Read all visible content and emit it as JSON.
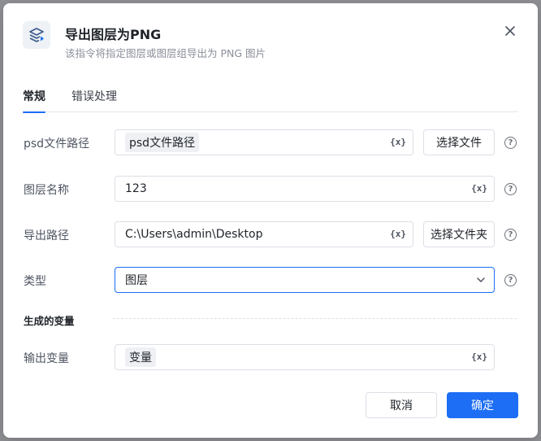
{
  "dialog": {
    "title": "导出图层为PNG",
    "subtitle": "该指令将指定图层或图层组导出为 PNG 图片"
  },
  "tabs": [
    {
      "label": "常规",
      "active": true
    },
    {
      "label": "错误处理",
      "active": false
    }
  ],
  "fields": {
    "psd_path": {
      "label": "psd文件路径",
      "value": "psd文件路径",
      "button": "选择文件"
    },
    "layer_name": {
      "label": "图层名称",
      "value": "123"
    },
    "export_path": {
      "label": "导出路径",
      "value": "C:\\Users\\admin\\Desktop",
      "button": "选择文件夹"
    },
    "type": {
      "label": "类型",
      "value": "图层"
    }
  },
  "variables": {
    "section_title": "生成的变量",
    "output": {
      "label": "输出变量",
      "value": "变量"
    }
  },
  "var_icon_text": "{x}",
  "help_icon_text": "?",
  "footer": {
    "cancel": "取消",
    "confirm": "确定"
  },
  "colors": {
    "accent": "#1d6ef5",
    "backdrop": "#8f9094"
  }
}
